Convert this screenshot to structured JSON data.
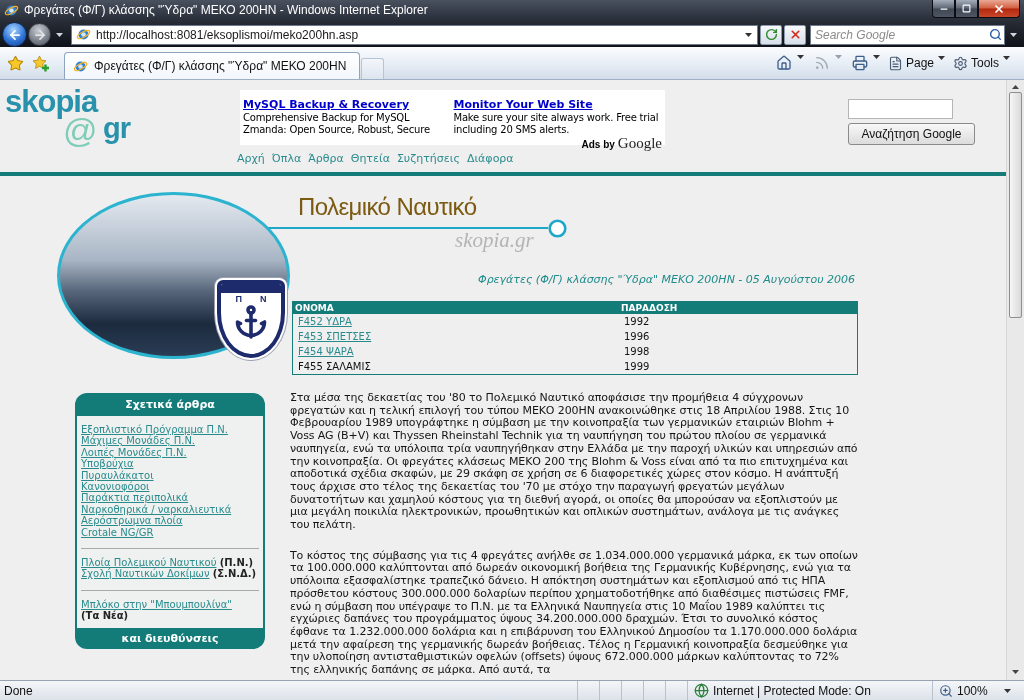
{
  "window": {
    "title": "Φρεγάτες (Φ/Γ) κλάσσης \"Ύδρα\" ΜΕΚΟ 200HN - Windows Internet Explorer"
  },
  "navigation": {
    "buttons": [
      {
        "kind": "back",
        "disabled": false
      },
      {
        "kind": "forward",
        "disabled": true
      }
    ]
  },
  "address_bar": {
    "url": "http://localhost:8081/eksoplismoi/meko200hn.asp"
  },
  "search_box": {
    "placeholder": "Search Google"
  },
  "tabs": [
    {
      "label": "Φρεγάτες (Φ/Γ) κλάσσης \"Ύδρα\" ΜΕΚΟ 200HN",
      "selected": true
    }
  ],
  "command_bar": {
    "buttons": [
      {
        "kind": "home",
        "disabled": false
      },
      {
        "kind": "feeds",
        "disabled": true
      },
      {
        "kind": "print",
        "disabled": false
      }
    ],
    "menus": [
      {
        "kind": "page",
        "label": "Page"
      },
      {
        "kind": "tools",
        "label": "Tools"
      }
    ]
  },
  "page": {
    "logo": {
      "name": "skopia",
      "symbol": "@",
      "suffix": "gr"
    },
    "ads": {
      "items": [
        {
          "title": "MySQL Backup & Recovery",
          "text": "Comprehensive Backup for MySQL Zmanda: Open Source, Robust, Secure"
        },
        {
          "title": "Monitor Your Web Site",
          "text": "Make sure your site always work. Free trial including 20 SMS alerts."
        }
      ],
      "attribution": "Ads by",
      "brand": "Google"
    },
    "site_search": {
      "button": "Αναζήτηση Google"
    },
    "nav": [
      "Αρχή",
      "Όπλα",
      "Άρθρα",
      "Θητεία",
      "Συζητήσεις",
      "Διάφορα"
    ],
    "banner": {
      "title": "Πολεμικό Ναυτικό",
      "site": "skopia.gr",
      "emblem_letters": [
        "Π",
        "Ν"
      ]
    },
    "sidebar": {
      "title": "Σχετικά άρθρα",
      "groups": [
        {
          "links": [
            {
              "link": "Εξοπλιστικό Πρόγραμμα Π.Ν."
            },
            {
              "link": "Μάχιμες Μονάδες Π.Ν."
            },
            {
              "link": "Λοιπές Μονάδες Π.Ν."
            },
            {
              "link": "Υποβρύχια"
            },
            {
              "link": "Πυραυλάκατοι"
            },
            {
              "link": "Κανονιοφόροι"
            },
            {
              "link": "Παράκτια περιπολικά"
            },
            {
              "link": "Ναρκοθηρικά / ναρκαλιευτικά"
            },
            {
              "link": "Αερόστρωμνα πλοία"
            },
            {
              "link": "Crotale NG/GR"
            }
          ]
        },
        {
          "links": [
            {
              "link": "Πλοία Πολεμικού Ναυτικού",
              "note": "(Π.Ν.)"
            },
            {
              "link": "Σχολή Ναυτικών Δοκίμων",
              "note": "(Σ.Ν.Δ.)"
            }
          ]
        },
        {
          "links": [
            {
              "link": "Μπλόκο στην \"Μπουμπουλίνα\"",
              "note": "(Τα Νέα)"
            }
          ]
        }
      ],
      "footer": "και διευθύνσεις"
    },
    "article": {
      "date_line": "Φρεγάτες (Φ/Γ) κλάσσης \"Ύδρα\" ΜΕΚΟ 200HN - 05 Αυγούστου 2006",
      "table": {
        "columns": [
          "ΟΝΟΜΑ",
          "ΠΑΡΑΔΟΣΗ"
        ],
        "rows": [
          {
            "name": "F452 ΥΔΡΑ",
            "delivery": "1992",
            "linked": true
          },
          {
            "name": "F453 ΣΠΕΤΣΕΣ",
            "delivery": "1996",
            "linked": true
          },
          {
            "name": "F454 ΨΑΡΑ",
            "delivery": "1998",
            "linked": true
          },
          {
            "name": "F455 ΣΑΛΑΜΙΣ",
            "delivery": "1999",
            "linked": false
          }
        ]
      },
      "paragraphs": [
        "Στα μέσα της δεκαετίας του '80 το Πολεμικό Ναυτικό αποφάσισε την προμήθεια 4 σύγχρονων φρεγατών και η τελική επιλογή του τύπου ΜΕΚΟ 200HN ανακοινώθηκε στις 18 Απριλίου 1988. Στις 10 Φεβρουαρίου 1989 υπογράφτηκε η σύμβαση με την κοινοπραξία των γερμανικών εταιριών Blohm + Voss AG (B+V) και Thyssen Rheinstahl Technik για τη ναυπήγηση του πρώτου πλοίου σε γερμανικά ναυπηγεία, ενώ τα υπόλοιπα τρία ναυπηγήθηκαν στην Ελλάδα με την παροχή υλικών και υπηρεσιών από την κοινοπραξία. Οι φρεγάτες κλάσεως ΜΕΚΟ 200 της Blohm & Voss είναι από τα πιο επιτυχημένα και αποδοτικά σχέδια σκαφών, με 29 σκάφη σε χρήση σε 6 διαφορετικές χώρες στον κόσμο. Η ανάπτυξή τους άρχισε στο τέλος της δεκαετίας του '70 με στόχο την παραγωγή φρεγατών μεγάλων δυνατοτήτων και χαμηλού κόστους για τη διεθνή αγορά, οι οποίες θα μπορούσαν να εξοπλιστούν με μια μεγάλη ποικιλία ηλεκτρονικών, προωθητικών και οπλικών συστημάτων, ανάλογα με τις ανάγκες του πελάτη.",
        "Το κόστος της σύμβασης για τις 4 φρεγάτες ανήλθε σε 1.034.000.000 γερμανικά μάρκα, εκ των οποίων τα 100.000.000 καλύπτονται από δωρεάν οικονομική βοήθεια της Γερμανικής Κυβέρνησης, ενώ για τα υπόλοιπα εξασφαλίστηκε τραπεζικό δάνειο. Η απόκτηση συστημάτων και εξοπλισμού από τις ΗΠΑ πρόσθετου κόστους 300.000.000 δολαρίων περίπου χρηματοδοτήθηκε από διαθέσιμες πιστώσεις FMF, ενώ η σύμβαση που υπέγραψε το Π.Ν. με τα Ελληνικά Ναυπηγεία στις 10 Μαΐου 1989 καλύπτει τις εγχώριες δαπάνες του προγράμματος ύψους 34.200.000.000 δραχμών. Έτσι το συνολικό κόστος έφθανε τα 1.232.000.000 δολάρια και η επιβάρυνση του Ελληνικού Δημοσίου τα 1.170.000.000 δολάρια μετά την αφαίρεση της γερμανικής δωρεάν βοήθειας. Τέλος η Γερμανική κοινοπραξία δεσμεύθηκε για την υλοποίηση αντισταθμιστικών οφελών (offsets) ύψους 672.000.000 μάρκων καλύπτοντας το 72% της ελληνικής δαπάνης σε μάρκα. Από αυτά, τα"
      ]
    }
  },
  "status_bar": {
    "text": "Done",
    "zone": "Internet | Protected Mode: On",
    "zoom": "100%"
  }
}
